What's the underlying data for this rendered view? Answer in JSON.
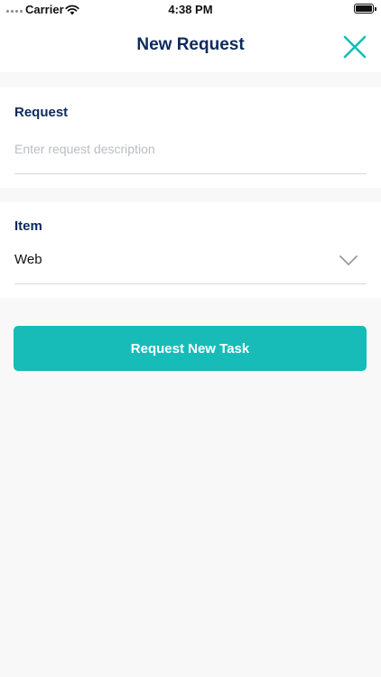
{
  "status_bar": {
    "carrier": "Carrier",
    "time": "4:38 PM",
    "wifi_icon": "wifi-icon",
    "battery_icon": "battery-icon"
  },
  "nav": {
    "title": "New Request",
    "close_icon": "close-icon"
  },
  "request_field": {
    "label": "Request",
    "placeholder": "Enter request description",
    "value": ""
  },
  "item_field": {
    "label": "Item",
    "selected": "Web",
    "chevron_icon": "chevron-down-icon"
  },
  "submit_button": {
    "label": "Request New Task"
  },
  "colors": {
    "accent": "#17bcb9",
    "title": "#0d2a5c",
    "background": "#f8f8f8"
  }
}
